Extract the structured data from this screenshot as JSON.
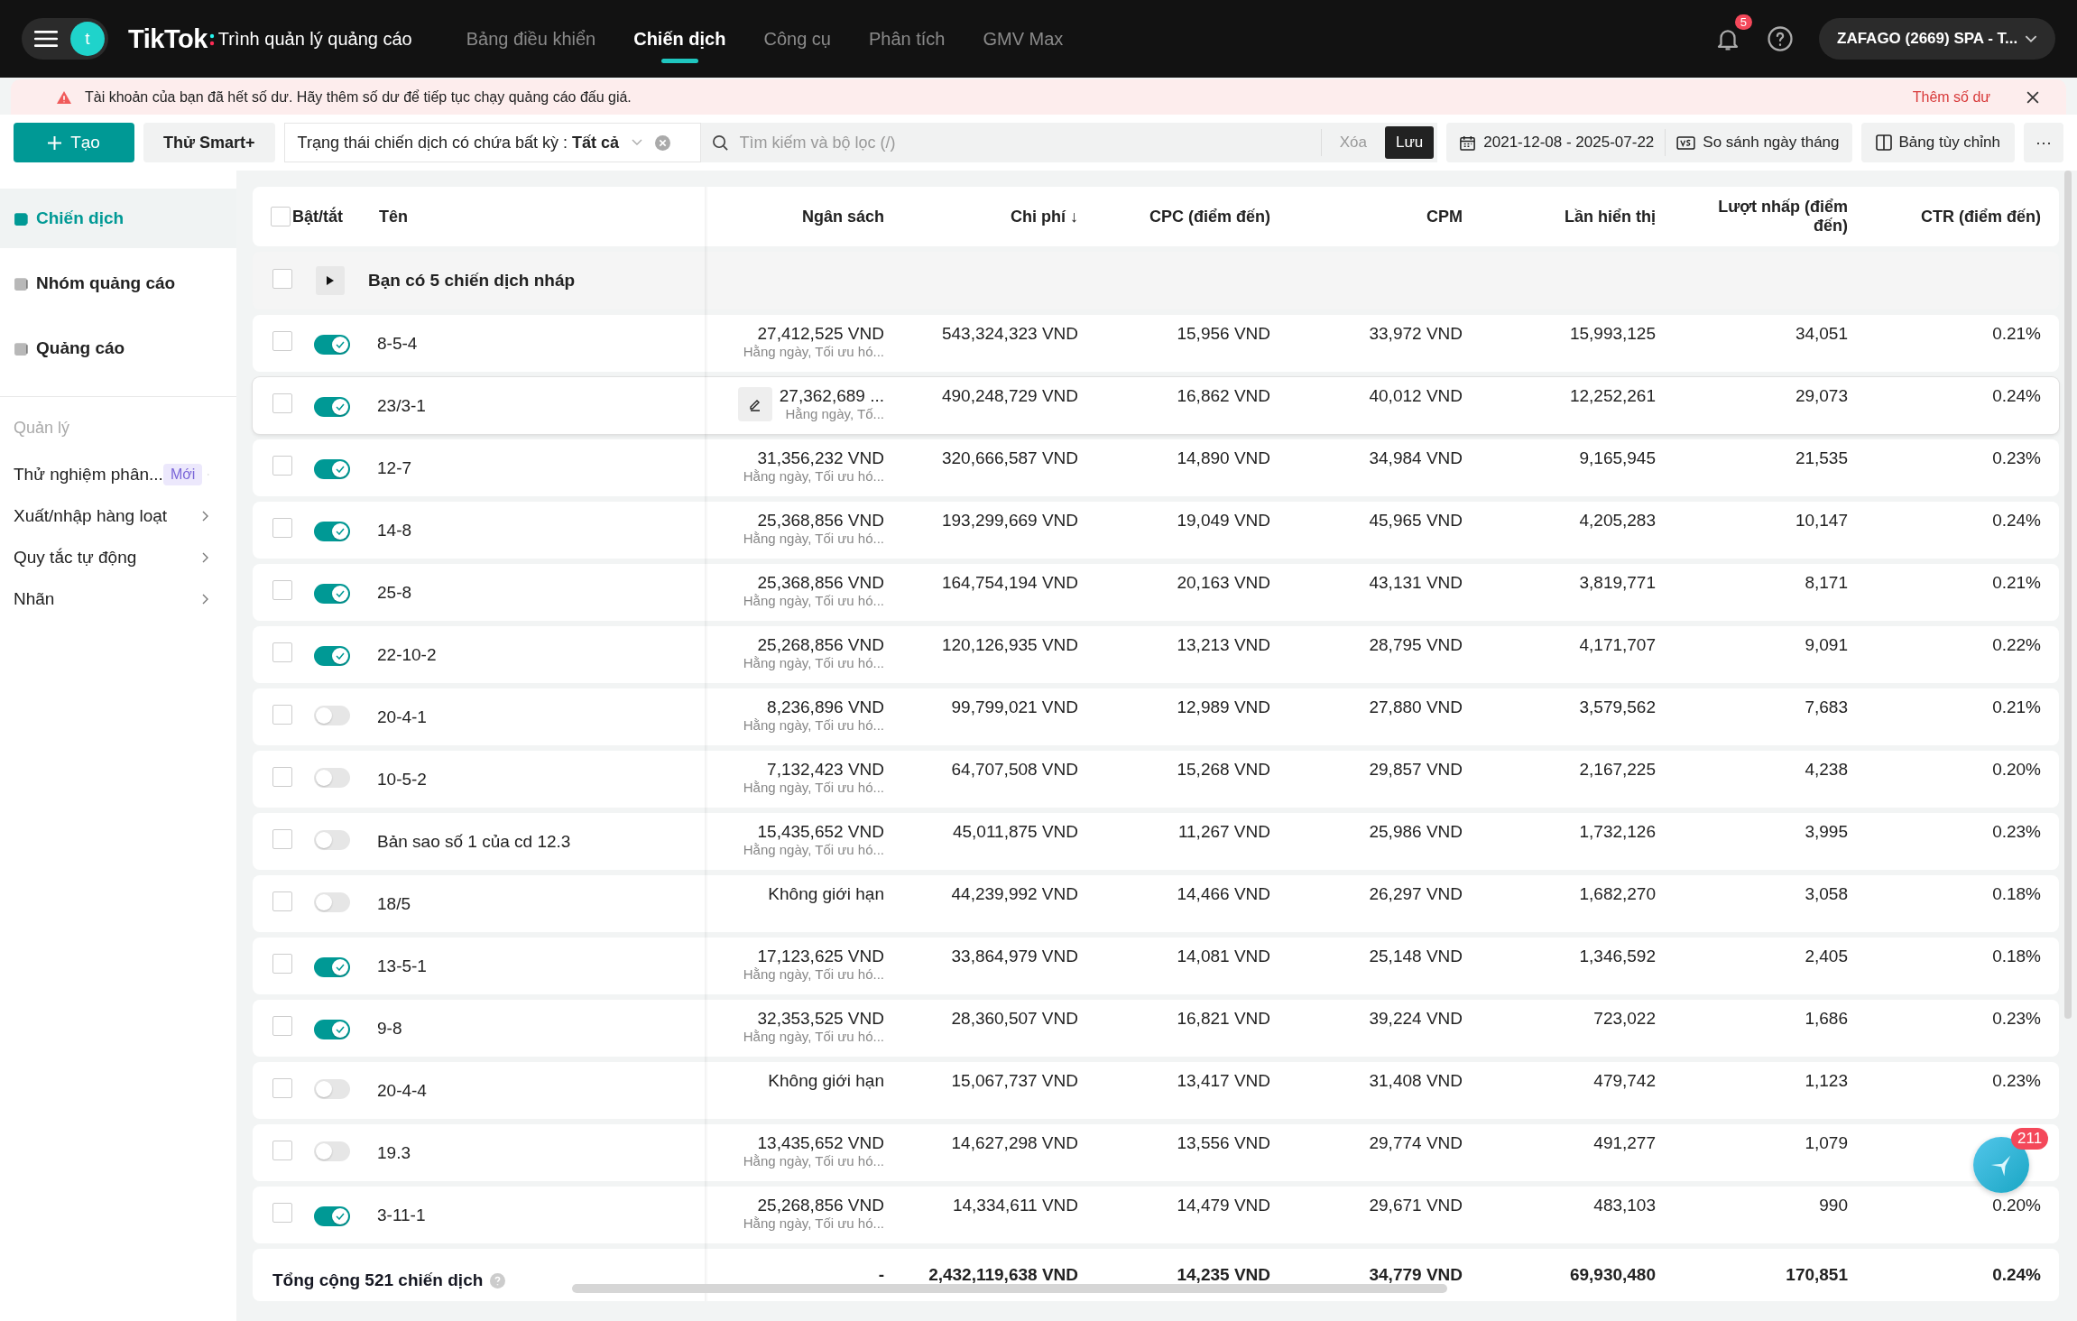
{
  "top_bar": {
    "avatar_letter": "t",
    "brand": "TikTok",
    "product": "Trình quản lý quảng cáo",
    "nav": [
      {
        "label": "Bảng điều khiển",
        "selected": false
      },
      {
        "label": "Chiến dịch",
        "selected": true
      },
      {
        "label": "Công cụ",
        "selected": false
      },
      {
        "label": "Phân tích",
        "selected": false
      },
      {
        "label": "GMV Max",
        "selected": false
      }
    ],
    "notification_count": "5",
    "account": "ZAFAGO (2669) SPA - T..."
  },
  "alert": {
    "message": "Tài khoản của bạn đã hết số dư. Hãy thêm số dư để tiếp tục chạy quảng cáo đấu giá.",
    "action": "Thêm số dư"
  },
  "toolbar": {
    "create": "Tạo",
    "smart": "Thử Smart+",
    "filter": "Trạng thái chiến dịch có chứa bất kỳ : **Tất cả**",
    "search_placeholder": "Tìm kiếm và bộ lọc (/)",
    "clear": "Xóa",
    "save": "Lưu",
    "date_range": "2021-12-08 - 2025-07-22",
    "compare": "So sánh ngày tháng",
    "customize": "Bảng tùy chỉnh",
    "more": "···"
  },
  "sidebar": {
    "levels": [
      {
        "label": "Chiến dịch",
        "selected": true
      },
      {
        "label": "Nhóm quảng cáo",
        "selected": false
      },
      {
        "label": "Quảng cáo",
        "selected": false
      }
    ],
    "section": "Quản lý",
    "items": [
      {
        "label": "Thử nghiệm phân...",
        "badge": "Mới"
      },
      {
        "label": "Xuất/nhập hàng loạt"
      },
      {
        "label": "Quy tắc tự động"
      },
      {
        "label": "Nhãn"
      }
    ]
  },
  "table": {
    "columns": [
      "Bật/tắt",
      "Tên",
      "Ngân sách",
      "Chi phí ↓",
      "CPC (điểm đến)",
      "CPM",
      "Lần hiển thị",
      "Lượt nhấp (điểm đến)",
      "CTR (điểm đến)"
    ],
    "select_all_checked": false,
    "draft_checked": false,
    "draft_notice": "Bạn có 5 chiến dịch nháp",
    "rows": [
      {
        "name": "8-5-4",
        "checked": false,
        "on": true,
        "hovered": false,
        "budget": "27,412,525 VND",
        "budget_note": "Hằng ngày, Tối ưu hó...",
        "values": [
          "543,324,323 VND",
          "15,956 VND",
          "33,972 VND",
          "15,993,125",
          "34,051",
          "0.21%"
        ]
      },
      {
        "name": "23/3-1",
        "checked": false,
        "on": true,
        "hovered": true,
        "budget": "27,362,689 ...",
        "budget_note": "Hằng ngày, Tố...",
        "values": [
          "490,248,729 VND",
          "16,862 VND",
          "40,012 VND",
          "12,252,261",
          "29,073",
          "0.24%"
        ]
      },
      {
        "name": "12-7",
        "checked": false,
        "on": true,
        "hovered": false,
        "budget": "31,356,232 VND",
        "budget_note": "Hằng ngày, Tối ưu hó...",
        "values": [
          "320,666,587 VND",
          "14,890 VND",
          "34,984 VND",
          "9,165,945",
          "21,535",
          "0.23%"
        ]
      },
      {
        "name": "14-8",
        "checked": false,
        "on": true,
        "hovered": false,
        "budget": "25,368,856 VND",
        "budget_note": "Hằng ngày, Tối ưu hó...",
        "values": [
          "193,299,669 VND",
          "19,049 VND",
          "45,965 VND",
          "4,205,283",
          "10,147",
          "0.24%"
        ]
      },
      {
        "name": "25-8",
        "checked": false,
        "on": true,
        "hovered": false,
        "budget": "25,368,856 VND",
        "budget_note": "Hằng ngày, Tối ưu hó...",
        "values": [
          "164,754,194 VND",
          "20,163 VND",
          "43,131 VND",
          "3,819,771",
          "8,171",
          "0.21%"
        ]
      },
      {
        "name": "22-10-2",
        "checked": false,
        "on": true,
        "hovered": false,
        "budget": "25,268,856 VND",
        "budget_note": "Hằng ngày, Tối ưu hó...",
        "values": [
          "120,126,935 VND",
          "13,213 VND",
          "28,795 VND",
          "4,171,707",
          "9,091",
          "0.22%"
        ]
      },
      {
        "name": "20-4-1",
        "checked": false,
        "on": false,
        "hovered": false,
        "budget": "8,236,896 VND",
        "budget_note": "Hằng ngày, Tối ưu hó...",
        "values": [
          "99,799,021 VND",
          "12,989 VND",
          "27,880 VND",
          "3,579,562",
          "7,683",
          "0.21%"
        ]
      },
      {
        "name": "10-5-2",
        "checked": false,
        "on": false,
        "hovered": false,
        "budget": "7,132,423 VND",
        "budget_note": "Hằng ngày, Tối ưu hó...",
        "values": [
          "64,707,508 VND",
          "15,268 VND",
          "29,857 VND",
          "2,167,225",
          "4,238",
          "0.20%"
        ]
      },
      {
        "name": "Bản sao số 1 của cd 12.3",
        "checked": false,
        "on": false,
        "hovered": false,
        "budget": "15,435,652 VND",
        "budget_note": "Hằng ngày, Tối ưu hó...",
        "values": [
          "45,011,875 VND",
          "11,267 VND",
          "25,986 VND",
          "1,732,126",
          "3,995",
          "0.23%"
        ]
      },
      {
        "name": "18/5",
        "checked": false,
        "on": false,
        "hovered": false,
        "budget": "Không giới hạn",
        "values": [
          "44,239,992 VND",
          "14,466 VND",
          "26,297 VND",
          "1,682,270",
          "3,058",
          "0.18%"
        ]
      },
      {
        "name": "13-5-1",
        "checked": false,
        "on": true,
        "hovered": false,
        "budget": "17,123,625 VND",
        "budget_note": "Hằng ngày, Tối ưu hó...",
        "values": [
          "33,864,979 VND",
          "14,081 VND",
          "25,148 VND",
          "1,346,592",
          "2,405",
          "0.18%"
        ]
      },
      {
        "name": "9-8",
        "checked": false,
        "on": true,
        "hovered": false,
        "budget": "32,353,525 VND",
        "budget_note": "Hằng ngày, Tối ưu hó...",
        "values": [
          "28,360,507 VND",
          "16,821 VND",
          "39,224 VND",
          "723,022",
          "1,686",
          "0.23%"
        ]
      },
      {
        "name": "20-4-4",
        "checked": false,
        "on": false,
        "hovered": false,
        "budget": "Không giới hạn",
        "values": [
          "15,067,737 VND",
          "13,417 VND",
          "31,408 VND",
          "479,742",
          "1,123",
          "0.23%"
        ]
      },
      {
        "name": "19.3",
        "checked": false,
        "on": false,
        "hovered": false,
        "budget": "13,435,652 VND",
        "budget_note": "Hằng ngày, Tối ưu hó...",
        "values": [
          "14,627,298 VND",
          "13,556 VND",
          "29,774 VND",
          "491,277",
          "1,079"
        ]
      },
      {
        "name": "3-11-1",
        "checked": false,
        "on": true,
        "hovered": false,
        "budget": "25,268,856 VND",
        "budget_note": "Hằng ngày, Tối ưu hó...",
        "values": [
          "14,334,611 VND",
          "14,479 VND",
          "29,671 VND",
          "483,103",
          "990",
          "0.20%"
        ]
      }
    ],
    "total": {
      "label": "Tổng cộng 521 chiến dịch",
      "budget": "-",
      "values": [
        "2,432,119,638 VND",
        "14,235 VND",
        "34,779 VND",
        "69,930,480",
        "170,851",
        "0.24%"
      ]
    }
  },
  "assistant": {
    "count": "211"
  }
}
